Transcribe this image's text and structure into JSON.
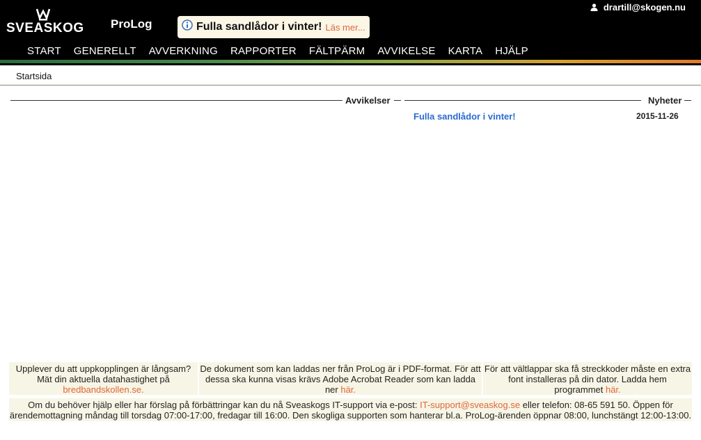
{
  "header": {
    "logo_text": "SVEASKOG",
    "app_name": "ProLog",
    "news_banner": {
      "title": "Fulla sandlådor i vinter!",
      "link": "Läs mer..."
    },
    "user": "drartill@skogen.nu"
  },
  "nav": {
    "items": [
      "START",
      "GENERELLT",
      "AVVERKNING",
      "RAPPORTER",
      "FÄLTPÄRM",
      "AVVIKELSE",
      "KARTA",
      "HJÄLP"
    ]
  },
  "breadcrumb": "Startsida",
  "panels": {
    "deviations": {
      "label": "Avvikelser"
    },
    "news": {
      "label": "Nyheter",
      "items": [
        {
          "title": "Fulla sandlådor i vinter!",
          "date": "2015-11-26"
        }
      ]
    }
  },
  "footer": {
    "cell1": {
      "text": "Upplever du att uppkopplingen är långsam? Mät din aktuella datahastighet på",
      "link": "bredbandskollen.se."
    },
    "cell2": {
      "text": "De dokument som kan laddas ner från ProLog är i PDF-format. För att dessa ska kunna visas krävs Adobe Acrobat Reader som kan ladda ner",
      "link": "här."
    },
    "cell3": {
      "text": "För att vältlappar ska få streckkoder måste en extra font installeras på din dator. Ladda hem programmet",
      "link": "här."
    },
    "support": {
      "text_before": "Om du behöver hjälp eller har förslag på förbättringar kan du nå Sveaskogs IT-support via e-post:",
      "email": "IT-support@sveaskog.se",
      "text_after": "eller telefon: 08-65 591 50. Öppen för ärendemottagning måndag till torsdag 07:00-17:00, fredagar till 16:00. Den skogliga supporten som hanterar bl.a. ProLog-ärenden öppnar 08:00, lunchstängt 12:00-13:00."
    }
  },
  "colors": {
    "accent_link": "#e0663a",
    "news_link": "#2a6bd0",
    "header_bg": "#000000",
    "footer_bg": "#f7f5e5"
  },
  "icons": {
    "info": "info-icon",
    "user": "user-icon",
    "logo": "crown-icon"
  }
}
